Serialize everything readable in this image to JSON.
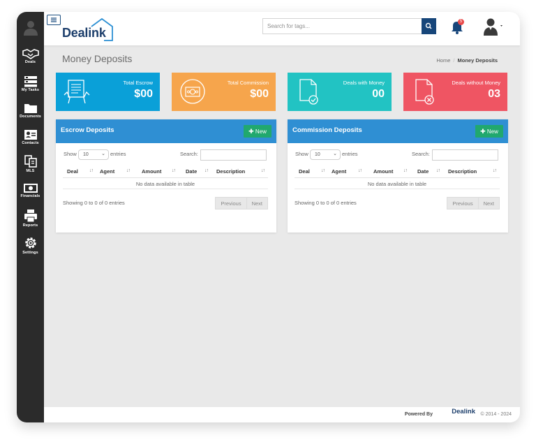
{
  "app": {
    "logo_text": "Dealink"
  },
  "colors": {
    "sidebar": "#2b2b2b",
    "brand": "#1c3e6b",
    "panel_header": "#2f8fd3",
    "new_button": "#21a86e",
    "escrow": "#0aa0d8",
    "commission": "#f6a54c",
    "with_money": "#22c3c3",
    "without_money": "#ef5563"
  },
  "sidebar": {
    "items": [
      {
        "label": "Deals",
        "icon": "handshake-icon"
      },
      {
        "label": "My Tasks",
        "icon": "tasks-icon"
      },
      {
        "label": "Documents",
        "icon": "folder-icon"
      },
      {
        "label": "Contacts",
        "icon": "contact-card-icon"
      },
      {
        "label": "MLS",
        "icon": "mls-icon"
      },
      {
        "label": "Financials",
        "icon": "money-icon"
      },
      {
        "label": "Reports",
        "icon": "printer-icon"
      },
      {
        "label": "Settings",
        "icon": "gear-icon"
      }
    ]
  },
  "header": {
    "search_placeholder": "Search for tags...",
    "notification_count": "5"
  },
  "page": {
    "title": "Money Deposits",
    "breadcrumb": [
      "Home",
      "Money Deposits"
    ]
  },
  "stats": [
    {
      "title": "Total Escrow",
      "value": "$00",
      "icon": "escrow-icon"
    },
    {
      "title": "Total Commission",
      "value": "$00",
      "icon": "commission-icon"
    },
    {
      "title": "Deals with Money",
      "value": "00",
      "icon": "document-check-icon"
    },
    {
      "title": "Deals without Money",
      "value": "03",
      "icon": "document-x-icon"
    }
  ],
  "panels": [
    {
      "title": "Escrow Deposits",
      "new_label": "New",
      "show_label": "Show",
      "entries_value": "10",
      "entries_label": "entries",
      "search_label": "Search:",
      "columns": [
        "Deal",
        "Agent",
        "Amount",
        "Date",
        "Description"
      ],
      "empty_text": "No data available in table",
      "info": "Showing 0 to 0 of 0 entries",
      "prev": "Previous",
      "next": "Next"
    },
    {
      "title": "Commission Deposits",
      "new_label": "New",
      "show_label": "Show",
      "entries_value": "10",
      "entries_label": "entries",
      "search_label": "Search:",
      "columns": [
        "Deal",
        "Agent",
        "Amount",
        "Date",
        "Description"
      ],
      "empty_text": "No data available in table",
      "info": "Showing 0 to 0 of 0 entries",
      "prev": "Previous",
      "next": "Next"
    }
  ],
  "footer": {
    "powered_by": "Powered By",
    "logo_text": "Dealink",
    "copyright": "© 2014 - 2024"
  }
}
